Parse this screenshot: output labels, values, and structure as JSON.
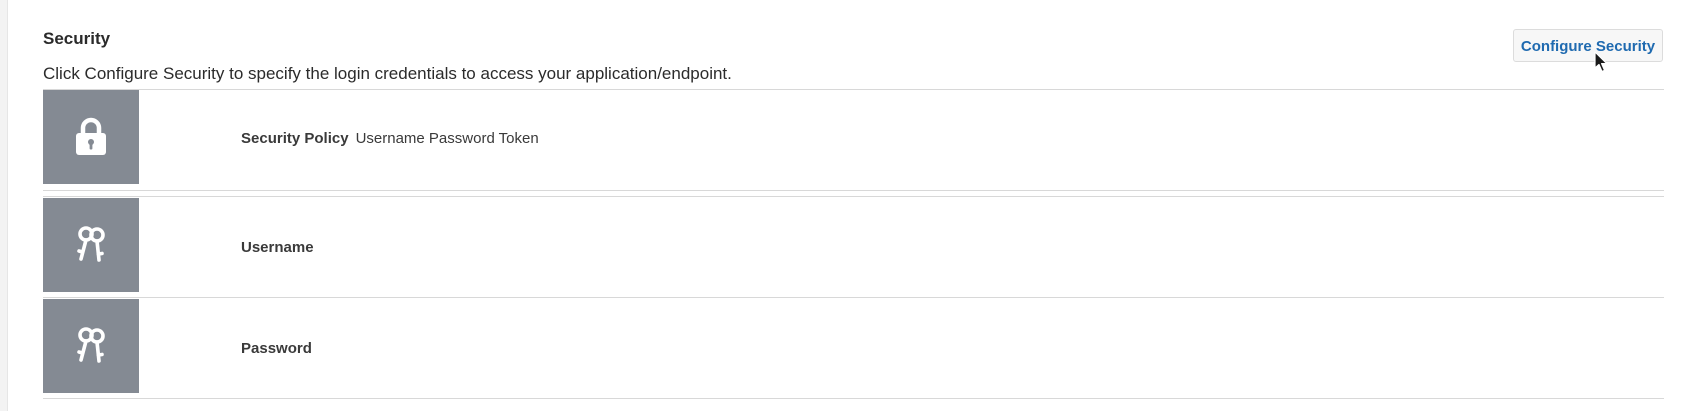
{
  "security": {
    "title": "Security",
    "description": "Click Configure Security to specify the login credentials to access your application/endpoint.",
    "configure_button": "Configure Security",
    "rows": [
      {
        "icon": "lock-icon",
        "label": "Security Policy",
        "value": "Username Password Token"
      },
      {
        "icon": "keys-icon",
        "label": "Username",
        "value": ""
      },
      {
        "icon": "keys-icon",
        "label": "Password",
        "value": ""
      }
    ]
  },
  "colors": {
    "tile_background": "#848a93",
    "button_text": "#1f6ab0",
    "divider": "#d8d8d8"
  }
}
